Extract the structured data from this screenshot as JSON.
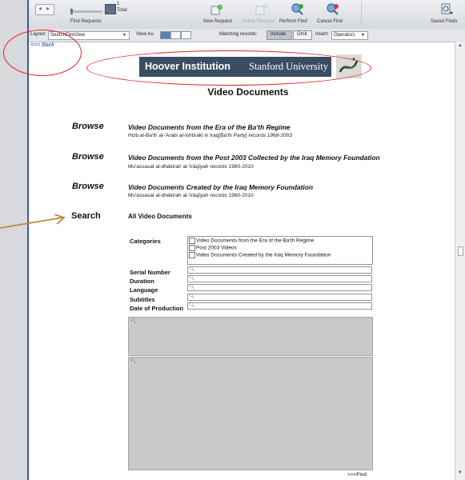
{
  "toolbar": {
    "record_number": "1",
    "total_count": "1",
    "total_label": "Total",
    "find_requests_label": "Find Requests",
    "new_request_label": "New Request",
    "delete_request_label": "Delete Request",
    "perform_find_label": "Perform Find",
    "cancel_find_label": "Cancel Find",
    "saved_finds_label": "Saved Finds"
  },
  "layoutbar": {
    "layout_label": "Layout:",
    "layout_value": "SearchFilmView",
    "view_as_label": "View As:",
    "matching_label": "Matching records:",
    "include_label": "Include",
    "omit_label": "Omit",
    "insert_label": "Insert:",
    "operators_label": "Operators"
  },
  "page": {
    "back_link": "<<< Back",
    "banner_title": "Hoover Institution",
    "banner_subtitle": "Stanford University",
    "title": "Video Documents",
    "browse_label": "Browse",
    "search_label": "Search",
    "search_all_label": "All Video Documents",
    "find_link": ">>>Find"
  },
  "collections": [
    {
      "title": "Video Documents from the Era of the Ba'th Regime",
      "subtitle": "Hizb al-Ba'th al-'Arabi al-Ishtiraki in Iraq[Ba'th Party] records 1968-2003"
    },
    {
      "title": "Video Documents from the Post 2003 Collected by the Iraq Memory Foundation",
      "subtitle": "Mu'assasat al-dhākirah al-'Irāqīyah records 1980-2010"
    },
    {
      "title": "Video Documents Created by the Iraq Memory Foundation",
      "subtitle": "Mu'assasat al-dhākirah al-'Irāqīyah records 1980-2010"
    }
  ],
  "search_form": {
    "categories_label": "Categories",
    "categories": [
      "Video Documents from the Era of the Ba'th Regime",
      "Post 2003 Videos",
      "Video Documents Created by the Iraq Memory Foundation"
    ],
    "fields": [
      "Serial Number",
      "Duration",
      "Language",
      "Subtitles",
      "Date of Production"
    ]
  },
  "colors": {
    "annotation_red": "#e02424",
    "arrow": "#b8893e",
    "banner_bg": "#3b4d63"
  }
}
